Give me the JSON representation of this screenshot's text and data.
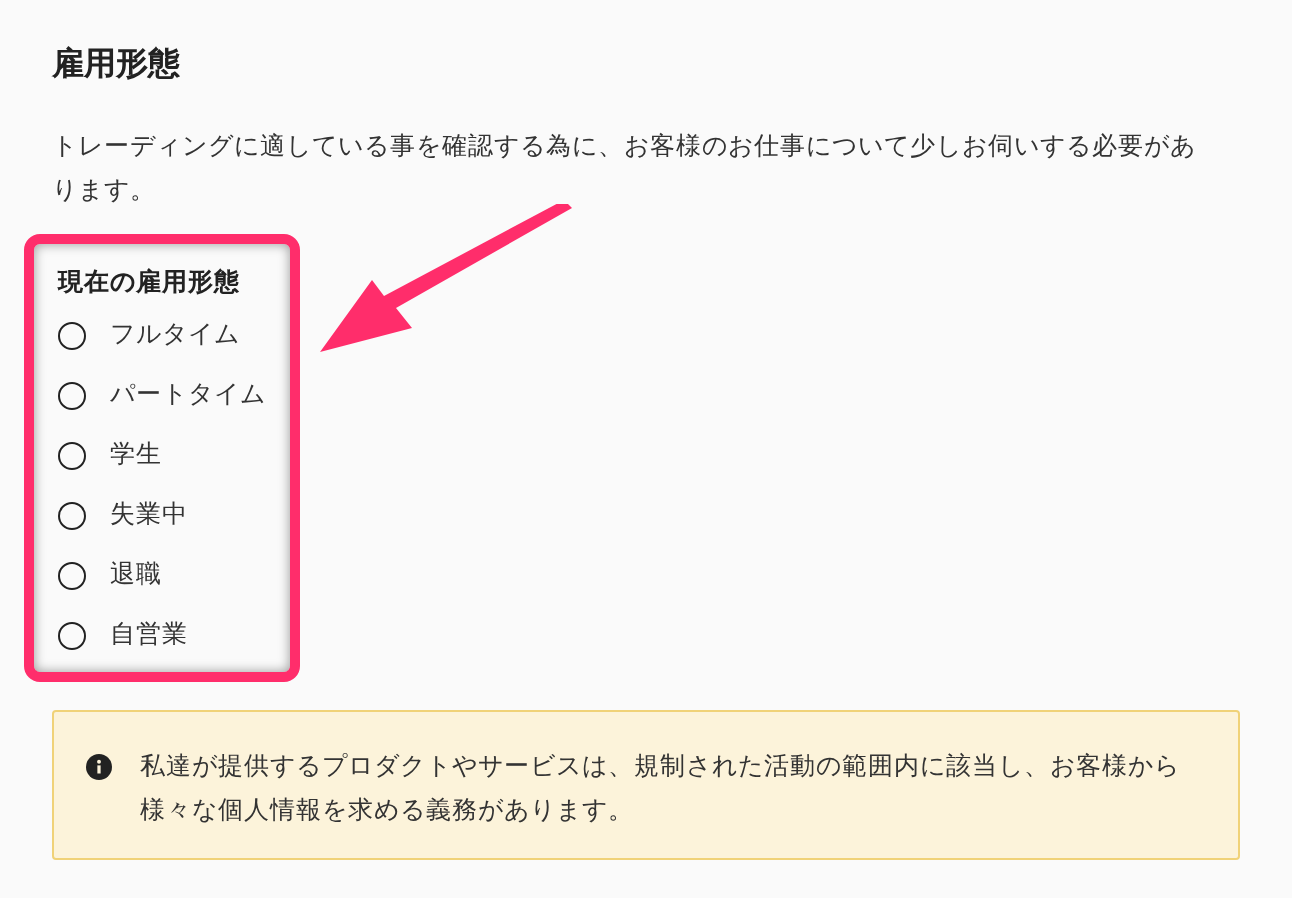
{
  "heading": "雇用形態",
  "description": "トレーディングに適している事を確認する為に、お客様のお仕事について少しお伺いする必要があります。",
  "employment_field": {
    "label": "現在の雇用形態",
    "highlighted": true,
    "options": [
      {
        "label": "フルタイム",
        "selected": false
      },
      {
        "label": "パートタイム",
        "selected": false
      },
      {
        "label": "学生",
        "selected": false
      },
      {
        "label": "失業中",
        "selected": false
      },
      {
        "label": "退職",
        "selected": false
      },
      {
        "label": "自営業",
        "selected": false
      }
    ]
  },
  "notice": {
    "text": "私達が提供するプロダクトやサービスは、規制された活動の範囲内に該当し、お客様から様々な個人情報を求める義務があります。"
  }
}
